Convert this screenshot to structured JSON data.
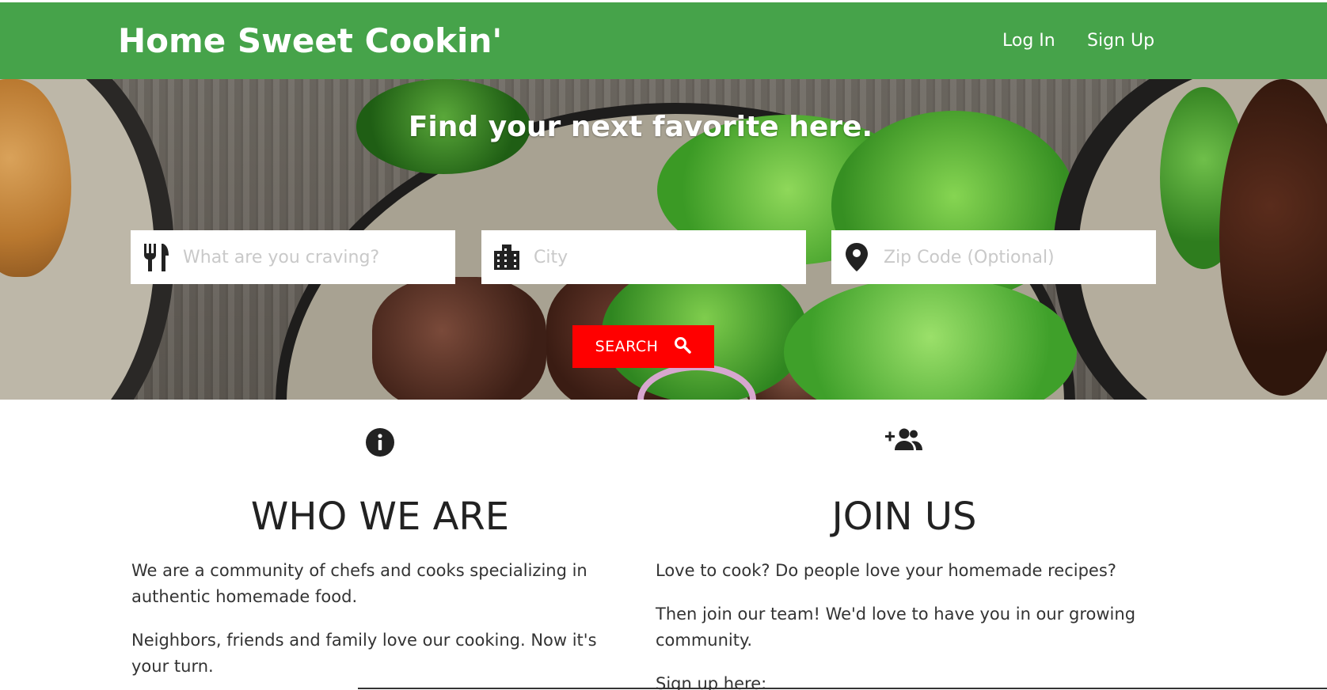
{
  "colors": {
    "navbar": "#46a34a",
    "search_button": "#ff0000",
    "placeholder": "#c9c9c9"
  },
  "navbar": {
    "brand": "Home Sweet Cookin'",
    "login_label": "Log In",
    "signup_label": "Sign Up"
  },
  "hero": {
    "title": "Find your next favorite here.",
    "search": {
      "craving": {
        "icon": "utensils-icon",
        "placeholder": "What are you craving?",
        "value": ""
      },
      "city": {
        "icon": "building-icon",
        "placeholder": "City",
        "value": ""
      },
      "zip": {
        "icon": "map-pin-icon",
        "placeholder": "Zip Code (Optional)",
        "value": ""
      },
      "button_label": "SEARCH",
      "button_icon": "search-icon"
    }
  },
  "who_we_are": {
    "icon": "info-icon",
    "heading": "WHO WE ARE",
    "paragraphs": [
      "We are a community of chefs and cooks specializing in authentic homemade food.",
      "Neighbors, friends and family love our cooking. Now it's your turn."
    ]
  },
  "join_us": {
    "icon": "add-user-icon",
    "heading": "JOIN US",
    "paragraphs": [
      "Love to cook? Do people love your homemade recipes?",
      "Then join our team! We'd love to have you in our growing community.",
      "Sign up here:"
    ]
  }
}
